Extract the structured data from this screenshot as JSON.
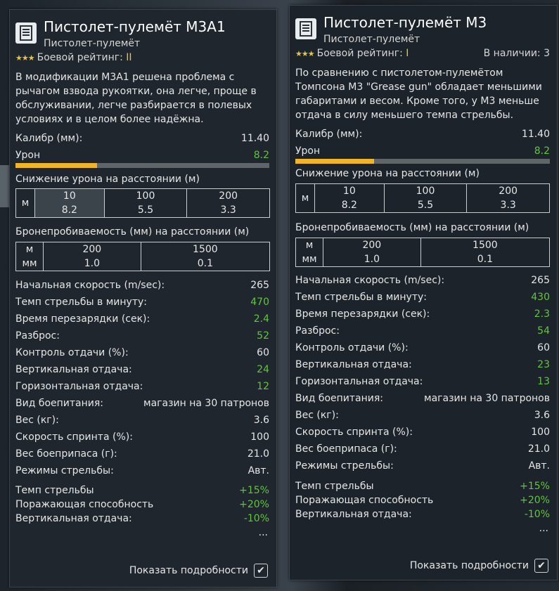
{
  "colors": {
    "accent_yellow": "#e7c53a",
    "green_value": "#62c63b",
    "damage_bar": "#f0b429"
  },
  "cards": [
    {
      "title": "Пистолет-пулемёт M3A1",
      "subtitle": "Пистолет-пулемёт",
      "stars": "★★★",
      "rating_label": "Боевой рейтинг:",
      "rating_value": "II",
      "description": "В модификации M3A1 решена проблема с рычагом взвода рукоятки, она легче, проще в обслуживании, легче разбирается в полевых условиях и в целом более надёжна.",
      "caliber_label": "Калибр (мм):",
      "caliber_value": "11.40",
      "damage_label": "Урон",
      "damage_value": "8.2",
      "damage_fill": 0.32,
      "falloff_label": "Снижение урона на расстоянии (м)",
      "falloff_unit": "м",
      "falloff": [
        {
          "d": "10",
          "v": "8.2"
        },
        {
          "d": "100",
          "v": "5.5"
        },
        {
          "d": "200",
          "v": "3.3"
        }
      ],
      "pen_label": "Бронепробиваемость (мм) на расстоянии (м)",
      "pen_unit1": "м",
      "pen_unit2": "мм",
      "pen": [
        {
          "d": "200",
          "v": "1.0"
        },
        {
          "d": "1500",
          "v": "0.1"
        }
      ],
      "stats": [
        {
          "label": "Начальная скорость (m/sec):",
          "value": "265",
          "green": false
        },
        {
          "label": "Темп стрельбы в минуту:",
          "value": "470",
          "green": true
        },
        {
          "label": "Время перезарядки (сек):",
          "value": "2.4",
          "green": true
        },
        {
          "label": "Разброс:",
          "value": "52",
          "green": true
        },
        {
          "label": "Контроль отдачи (%):",
          "value": "60",
          "green": false
        },
        {
          "label": "Вертикальная отдача:",
          "value": "24",
          "green": true
        },
        {
          "label": "Горизонтальная отдача:",
          "value": "12",
          "green": true
        },
        {
          "label": "Вид боепитания:",
          "value": "магазин на 30 патронов",
          "green": false
        },
        {
          "label": "Вес (кг):",
          "value": "3.6",
          "green": false
        },
        {
          "label": "Скорость спринта (%):",
          "value": "100",
          "green": false
        },
        {
          "label": "Вес боеприпаса (г):",
          "value": "21.0",
          "green": false
        },
        {
          "label": "Режимы стрельбы:",
          "value": "Авт.",
          "green": false
        }
      ],
      "mods": [
        {
          "label": "Темп стрельбы",
          "value": "+15%"
        },
        {
          "label": "Поражающая способность",
          "value": "+20%"
        },
        {
          "label": "Вертикальная отдача:",
          "value": "-10%"
        }
      ],
      "ellipsis": "...",
      "show_details": "Показать подробности"
    },
    {
      "title": "Пистолет-пулемёт M3",
      "subtitle": "Пистолет-пулемёт",
      "stars": "★★★",
      "rating_label": "Боевой рейтинг:",
      "rating_value": "I",
      "availability": "В наличии: 3",
      "description": "По сравнению с пистолетом-пулемётом Томпсона M3 \"Grease gun\" обладает меньшими габаритами и весом. Кроме того, у M3 меньше отдача в силу меньшего темпа стрельбы.",
      "caliber_label": "Калибр (мм):",
      "caliber_value": "11.40",
      "damage_label": "Урон",
      "damage_value": "8.2",
      "damage_fill": 0.31,
      "falloff_label": "Снижение урона на расстоянии (м)",
      "falloff_unit": "м",
      "falloff": [
        {
          "d": "10",
          "v": "8.2"
        },
        {
          "d": "100",
          "v": "5.5"
        },
        {
          "d": "200",
          "v": "3.3"
        }
      ],
      "pen_label": "Бронепробиваемость (мм) на расстоянии (м)",
      "pen_unit1": "м",
      "pen_unit2": "мм",
      "pen": [
        {
          "d": "200",
          "v": "1.0"
        },
        {
          "d": "1500",
          "v": "0.1"
        }
      ],
      "stats": [
        {
          "label": "Начальная скорость (m/sec):",
          "value": "265",
          "green": false
        },
        {
          "label": "Темп стрельбы в минуту:",
          "value": "430",
          "green": true
        },
        {
          "label": "Время перезарядки (сек):",
          "value": "2.3",
          "green": true
        },
        {
          "label": "Разброс:",
          "value": "54",
          "green": true
        },
        {
          "label": "Контроль отдачи (%):",
          "value": "60",
          "green": false
        },
        {
          "label": "Вертикальная отдача:",
          "value": "23",
          "green": true
        },
        {
          "label": "Горизонтальная отдача:",
          "value": "13",
          "green": true
        },
        {
          "label": "Вид боепитания:",
          "value": "магазин на 30 патронов",
          "green": false
        },
        {
          "label": "Вес (кг):",
          "value": "3.6",
          "green": false
        },
        {
          "label": "Скорость спринта (%):",
          "value": "100",
          "green": false
        },
        {
          "label": "Вес боеприпаса (г):",
          "value": "21.0",
          "green": false
        },
        {
          "label": "Режимы стрельбы:",
          "value": "Авт.",
          "green": false
        }
      ],
      "mods": [
        {
          "label": "Темп стрельбы",
          "value": "+15%"
        },
        {
          "label": "Поражающая способность",
          "value": "+20%"
        },
        {
          "label": "Вертикальная отдача:",
          "value": "-10%"
        }
      ],
      "ellipsis": "...",
      "show_details": "Показать подробности"
    }
  ]
}
